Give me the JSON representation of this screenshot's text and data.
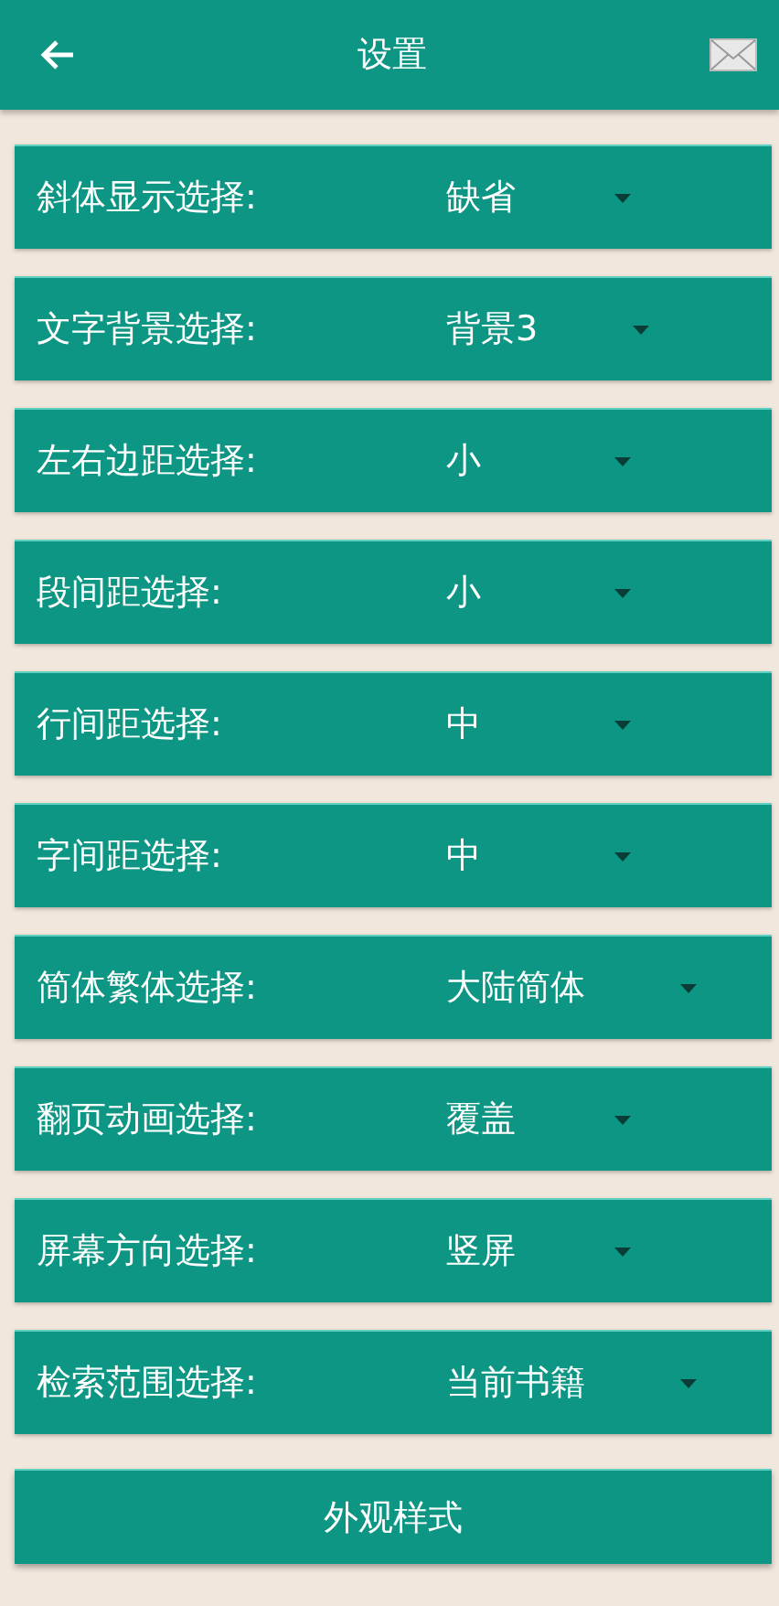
{
  "header": {
    "title": "设置"
  },
  "settings": [
    {
      "label": "斜体显示选择:",
      "value": "缺省"
    },
    {
      "label": "文字背景选择:",
      "value": "背景3"
    },
    {
      "label": "左右边距选择:",
      "value": "小"
    },
    {
      "label": "段间距选择:",
      "value": "小"
    },
    {
      "label": "行间距选择:",
      "value": "中"
    },
    {
      "label": "字间距选择:",
      "value": "中"
    },
    {
      "label": "简体繁体选择:",
      "value": "大陆简体"
    },
    {
      "label": "翻页动画选择:",
      "value": "覆盖"
    },
    {
      "label": "屏幕方向选择:",
      "value": "竖屏"
    },
    {
      "label": "检索范围选择:",
      "value": "当前书籍"
    }
  ],
  "button": {
    "label": "外观样式"
  }
}
